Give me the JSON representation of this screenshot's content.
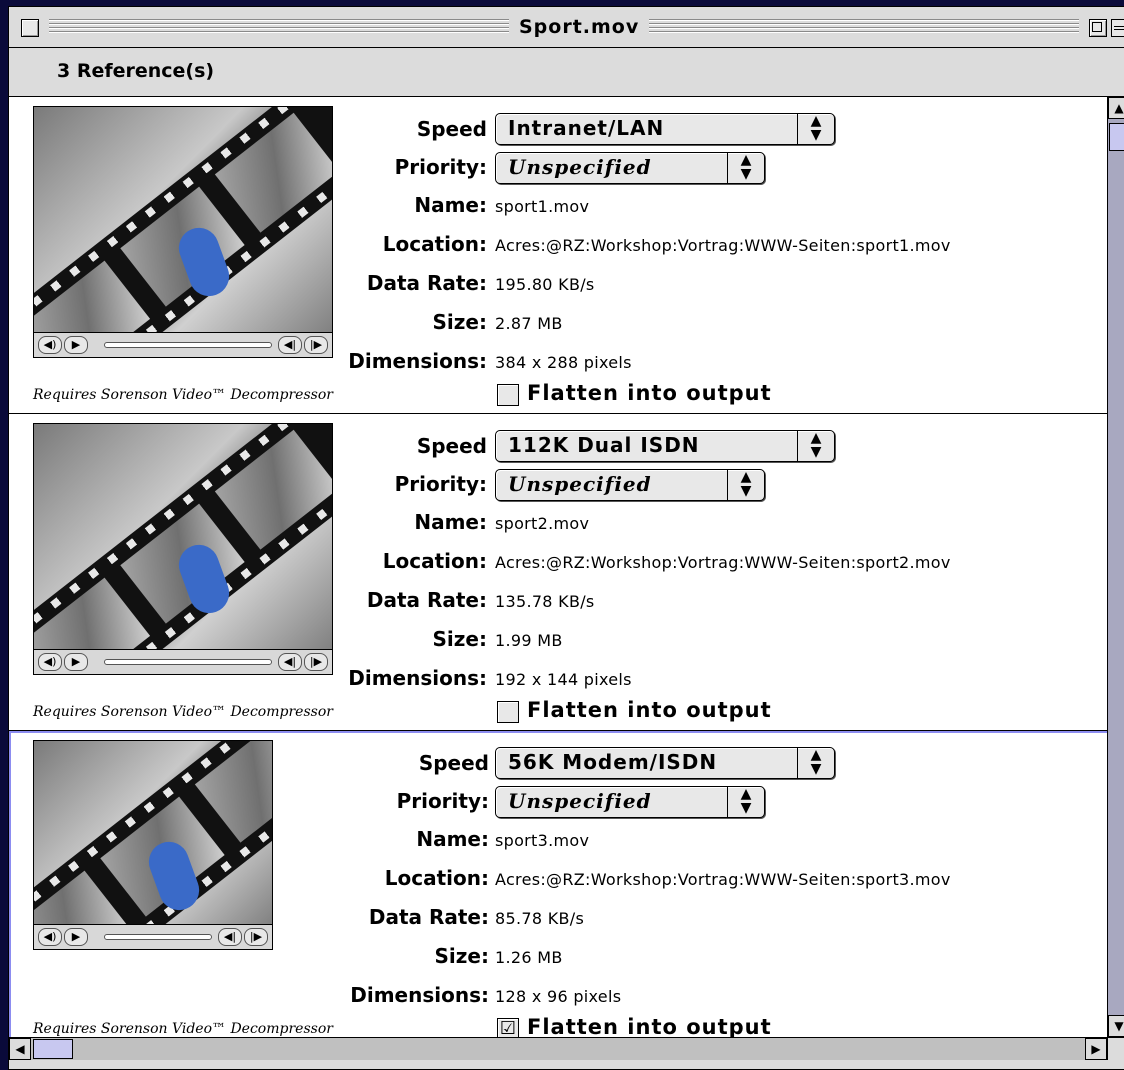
{
  "window": {
    "title": "Sport.mov"
  },
  "header": {
    "refs": "3 Reference(s)"
  },
  "labels": {
    "speed": "Speed",
    "priority": "Priority:",
    "name": "Name:",
    "location": "Location:",
    "data_rate": "Data Rate:",
    "size": "Size:",
    "dimensions": "Dimensions:",
    "flatten": "Flatten into output",
    "requires": "Requires Sorenson Video™ Decompressor"
  },
  "references": [
    {
      "speed": "Intranet/LAN",
      "priority": "Unspecified",
      "name": "sport1.mov",
      "location": "Acres:@RZ:Workshop:Vortrag:WWW-Seiten:sport1.mov",
      "data_rate": "195.80 KB/s",
      "size": "2.87 MB",
      "dimensions": "384 x 288 pixels",
      "flatten": false
    },
    {
      "speed": "112K Dual ISDN",
      "priority": "Unspecified",
      "name": "sport2.mov",
      "location": "Acres:@RZ:Workshop:Vortrag:WWW-Seiten:sport2.mov",
      "data_rate": "135.78 KB/s",
      "size": "1.99 MB",
      "dimensions": "192 x 144 pixels",
      "flatten": false
    },
    {
      "speed": "56K Modem/ISDN",
      "priority": "Unspecified",
      "name": "sport3.mov",
      "location": "Acres:@RZ:Workshop:Vortrag:WWW-Seiten:sport3.mov",
      "data_rate": "85.78 KB/s",
      "size": "1.26 MB",
      "dimensions": "128 x 96 pixels",
      "flatten": true
    }
  ],
  "icons": {
    "checkmark": "☑",
    "popup_arrows": "▲▼",
    "scroll_up": "▲",
    "scroll_down": "▼",
    "scroll_left": "◀",
    "scroll_right": "▶"
  }
}
